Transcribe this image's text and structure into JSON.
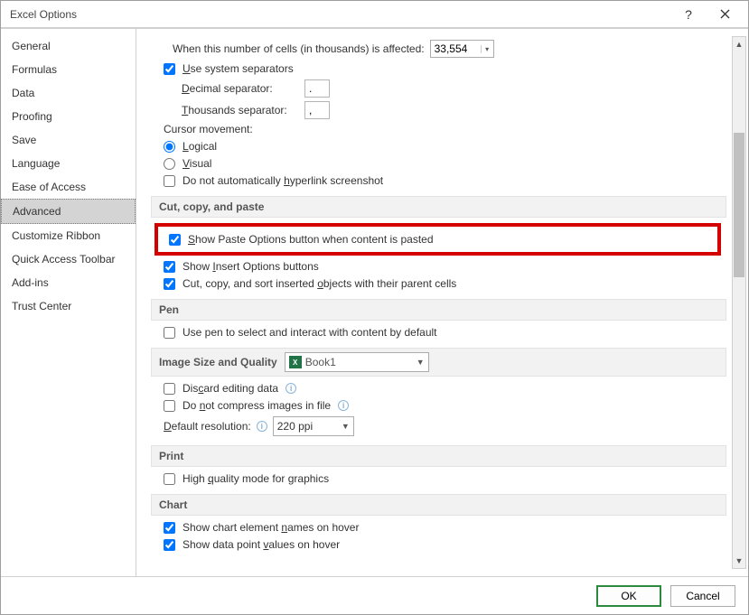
{
  "title": "Excel Options",
  "sidebar": {
    "items": [
      {
        "label": "General"
      },
      {
        "label": "Formulas"
      },
      {
        "label": "Data"
      },
      {
        "label": "Proofing"
      },
      {
        "label": "Save"
      },
      {
        "label": "Language"
      },
      {
        "label": "Ease of Access"
      },
      {
        "label": "Advanced",
        "selected": true
      },
      {
        "label": "Customize Ribbon"
      },
      {
        "label": "Quick Access Toolbar"
      },
      {
        "label": "Add-ins"
      },
      {
        "label": "Trust Center"
      }
    ]
  },
  "content": {
    "cells_affected_label": "When this number of cells (in thousands) is affected:",
    "cells_affected_value": "33,554",
    "use_system_separators": "Use system separators",
    "decimal_sep_label": "Decimal separator:",
    "decimal_sep_value": ".",
    "thousands_sep_label": "Thousands separator:",
    "thousands_sep_value": ",",
    "cursor_movement_label": "Cursor movement:",
    "cursor_logical": "Logical",
    "cursor_visual": "Visual",
    "no_auto_hyperlink": "Do not automatically hyperlink screenshot",
    "section_ccp": "Cut, copy, and paste",
    "show_paste_options": "Show Paste Options button when content is pasted",
    "show_insert_options": "Show Insert Options buttons",
    "cut_sort_objects": "Cut, copy, and sort inserted objects with their parent cells",
    "section_pen": "Pen",
    "use_pen": "Use pen to select and interact with content by default",
    "section_image": "Image Size and Quality",
    "image_target": "Book1",
    "discard_editing": "Discard editing data",
    "no_compress": "Do not compress images in file",
    "default_res_label": "Default resolution:",
    "default_res_value": "220 ppi",
    "section_print": "Print",
    "high_quality": "High quality mode for graphics",
    "section_chart": "Chart",
    "chart_element_names": "Show chart element names on hover",
    "chart_data_values": "Show data point values on hover"
  },
  "footer": {
    "ok": "OK",
    "cancel": "Cancel"
  }
}
